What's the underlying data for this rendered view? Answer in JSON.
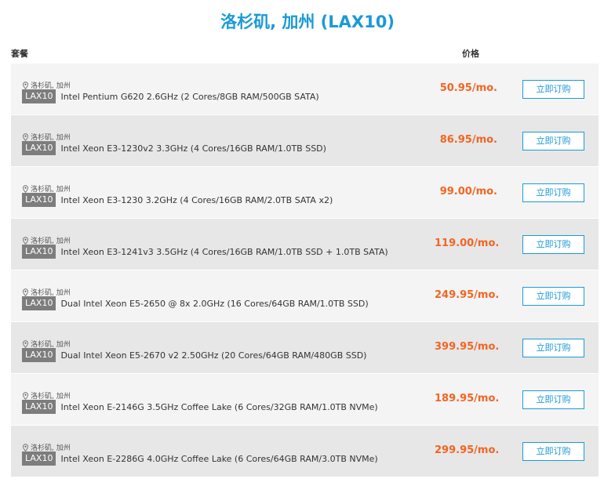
{
  "page": {
    "title": "洛杉矶, 加州 (LAX10)",
    "col_plan": "套餐",
    "col_price": "价格"
  },
  "colors": {
    "accent": "#1b9ad6",
    "price": "#f26522",
    "tag_bg": "#7d7d7d"
  },
  "plans": [
    {
      "location": "洛杉矶, 加州",
      "tag": "LAX10",
      "desc": "Intel Pentium G620 2.6GHz (2 Cores/8GB RAM/500GB SATA)",
      "price": "50.95/mo.",
      "button": "立即订购"
    },
    {
      "location": "洛杉矶, 加州",
      "tag": "LAX10",
      "desc": "Intel Xeon E3-1230v2 3.3GHz (4 Cores/16GB RAM/1.0TB SSD)",
      "price": "86.95/mo.",
      "button": "立即订购"
    },
    {
      "location": "洛杉矶, 加州",
      "tag": "LAX10",
      "desc": "Intel Xeon E3-1230 3.2GHz (4 Cores/16GB RAM/2.0TB SATA x2)",
      "price": "99.00/mo.",
      "button": "立即订购"
    },
    {
      "location": "洛杉矶, 加州",
      "tag": "LAX10",
      "desc": "Intel Xeon E3-1241v3 3.5GHz (4 Cores/16GB RAM/1.0TB SSD + 1.0TB SATA)",
      "price": "119.00/mo.",
      "button": "立即订购"
    },
    {
      "location": "洛杉矶, 加州",
      "tag": "LAX10",
      "desc": "Dual Intel Xeon E5-2650 @ 8x 2.0GHz (16 Cores/64GB RAM/1.0TB SSD)",
      "price": "249.95/mo.",
      "button": "立即订购"
    },
    {
      "location": "洛杉矶, 加州",
      "tag": "LAX10",
      "desc": "Dual Intel Xeon E5-2670 v2 2.50GHz (20 Cores/64GB RAM/480GB SSD)",
      "price": "399.95/mo.",
      "button": "立即订购"
    },
    {
      "location": "洛杉矶, 加州",
      "tag": "LAX10",
      "desc": "Intel Xeon E-2146G 3.5GHz Coffee Lake (6 Cores/32GB RAM/1.0TB NVMe)",
      "price": "189.95/mo.",
      "button": "立即订购"
    },
    {
      "location": "洛杉矶, 加州",
      "tag": "LAX10",
      "desc": "Intel Xeon E-2286G 4.0GHz Coffee Lake (6 Cores/64GB RAM/3.0TB NVMe)",
      "price": "299.95/mo.",
      "button": "立即订购"
    }
  ]
}
